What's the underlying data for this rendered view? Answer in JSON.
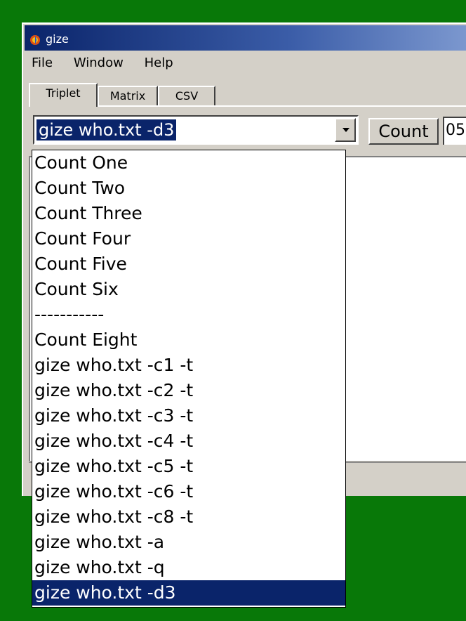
{
  "window": {
    "title": "gize",
    "colors": {
      "desktop": "#087808",
      "title_bar": "#0a246a",
      "highlight": "#0a246a",
      "face": "#d4d0c8"
    }
  },
  "menu": [
    {
      "label": "File"
    },
    {
      "label": "Window"
    },
    {
      "label": "Help"
    }
  ],
  "tabs": [
    {
      "label": "Triplet",
      "active": true
    },
    {
      "label": "Matrix",
      "active": false
    },
    {
      "label": "CSV",
      "active": false
    }
  ],
  "toolbar": {
    "combo_value": "gize who.txt -d3",
    "count_label": "Count",
    "count_field_value": "05"
  },
  "dropdown": {
    "items": [
      {
        "label": "Count One"
      },
      {
        "label": "Count Two"
      },
      {
        "label": "Count Three"
      },
      {
        "label": "Count Four"
      },
      {
        "label": "Count Five"
      },
      {
        "label": "Count Six"
      },
      {
        "label": "-----------"
      },
      {
        "label": "Count Eight"
      },
      {
        "label": "gize who.txt -c1 -t"
      },
      {
        "label": "gize who.txt -c2 -t"
      },
      {
        "label": "gize who.txt -c3 -t"
      },
      {
        "label": "gize who.txt -c4 -t"
      },
      {
        "label": "gize who.txt -c5 -t"
      },
      {
        "label": "gize who.txt -c6 -t"
      },
      {
        "label": "gize who.txt -c8 -t"
      },
      {
        "label": "gize who.txt -a"
      },
      {
        "label": "gize who.txt -q"
      },
      {
        "label": "gize who.txt -d3",
        "selected": true
      }
    ]
  },
  "icons": {
    "app": "gize-app-icon",
    "combo_arrow": "chevron-down-icon"
  }
}
